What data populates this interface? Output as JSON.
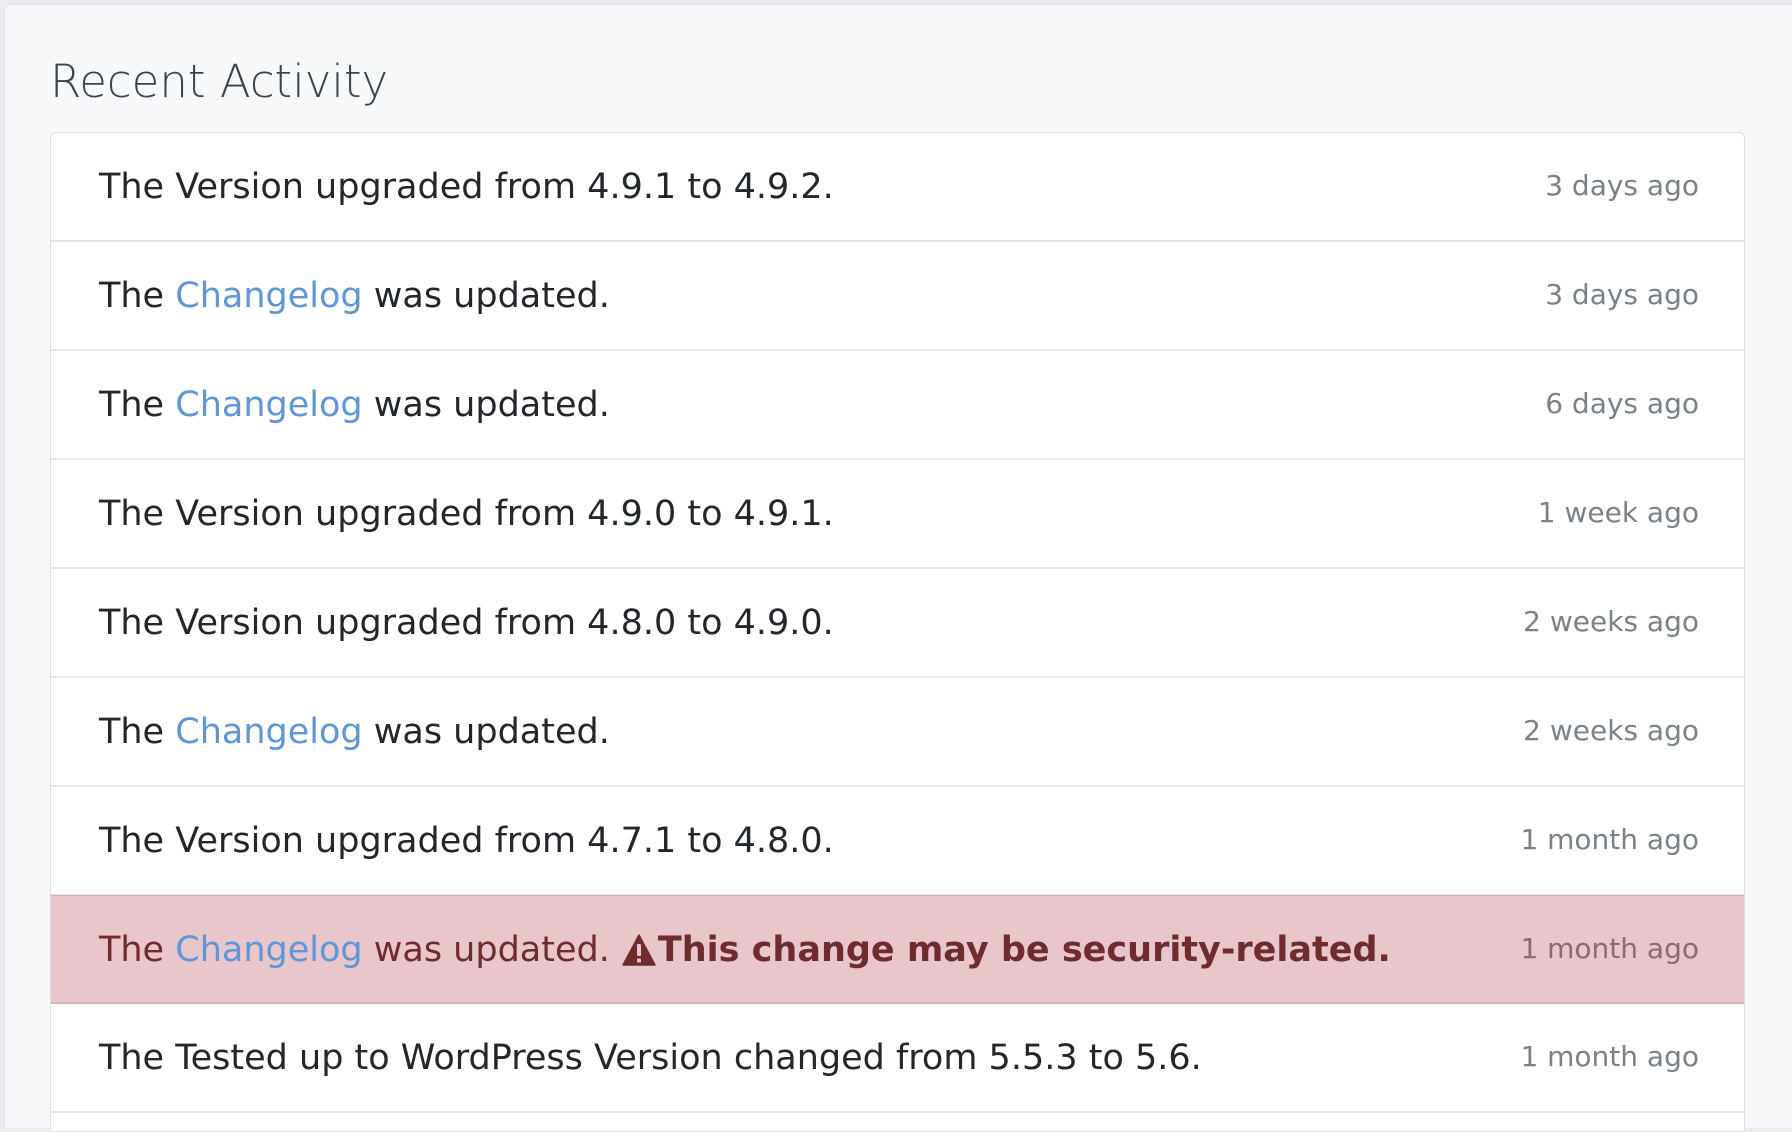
{
  "page": {
    "title": "Recent Activity"
  },
  "colors": {
    "link": "#5f96d6",
    "danger_bg": "#e8c6cb",
    "danger_text": "#6e2b30",
    "muted": "#7a8187"
  },
  "activity": [
    {
      "text": "The Version upgraded from 4.9.1 to 4.9.2.",
      "time": "3 days ago"
    },
    {
      "prefix": "The",
      "link": "Changelog",
      "suffix": "was updated.",
      "time": "3 days ago"
    },
    {
      "prefix": "The",
      "link": "Changelog",
      "suffix": "was updated.",
      "time": "6 days ago"
    },
    {
      "text": "The Version upgraded from 4.9.0 to 4.9.1.",
      "time": "1 week ago"
    },
    {
      "text": "The Version upgraded from 4.8.0 to 4.9.0.",
      "time": "2 weeks ago"
    },
    {
      "prefix": "The",
      "link": "Changelog",
      "suffix": "was updated.",
      "time": "2 weeks ago"
    },
    {
      "text": "The Version upgraded from 4.7.1 to 4.8.0.",
      "time": "1 month ago"
    },
    {
      "prefix": "The",
      "link": "Changelog",
      "suffix": "was updated.",
      "warning": "This change may be security-related.",
      "warning_icon": "warning-triangle-icon",
      "time": "1 month ago"
    },
    {
      "text": "The Tested up to WordPress Version changed from 5.5.3 to 5.6.",
      "time": "1 month ago"
    }
  ]
}
